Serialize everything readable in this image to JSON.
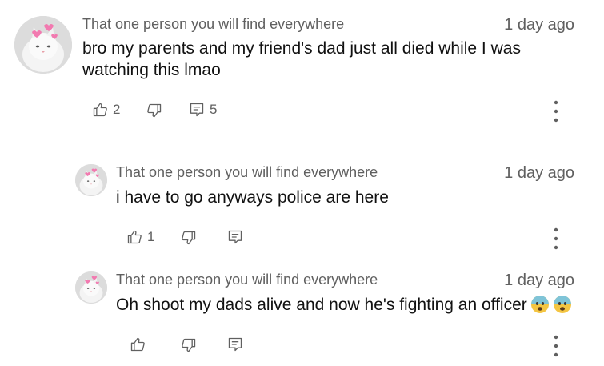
{
  "comments": [
    {
      "author": "That one person you will find everywhere",
      "timestamp": "1 day ago",
      "text_line1": "bro my parents and my friend's dad just all died while I was",
      "text_line2": "watching this lmao",
      "likes": "2",
      "replies": "5",
      "avatar_icon": "white-cat-with-pink-hearts-avatar"
    },
    {
      "author": "That one person you will find everywhere",
      "timestamp": "1 day ago",
      "text": "i have to go anyways police are here",
      "likes": "1",
      "avatar_icon": "white-cat-with-pink-hearts-avatar"
    },
    {
      "author": "That one person you will find everywhere",
      "timestamp": "1 day ago",
      "text": "Oh shoot my dads alive and now he's fighting an officer",
      "emojis": [
        "worried-face-emoji",
        "worried-face-emoji"
      ],
      "avatar_icon": "white-cat-with-pink-hearts-avatar"
    }
  ],
  "icons": {
    "like": "thumbs-up-icon",
    "dislike": "thumbs-down-icon",
    "reply": "reply-comment-icon",
    "more": "vertical-ellipsis-icon"
  },
  "colors": {
    "text_primary": "#111111",
    "text_secondary": "#606060",
    "heart_pink": "#f27ab0",
    "emoji_blue": "#7fc4d8",
    "emoji_yellow": "#f4c542"
  }
}
